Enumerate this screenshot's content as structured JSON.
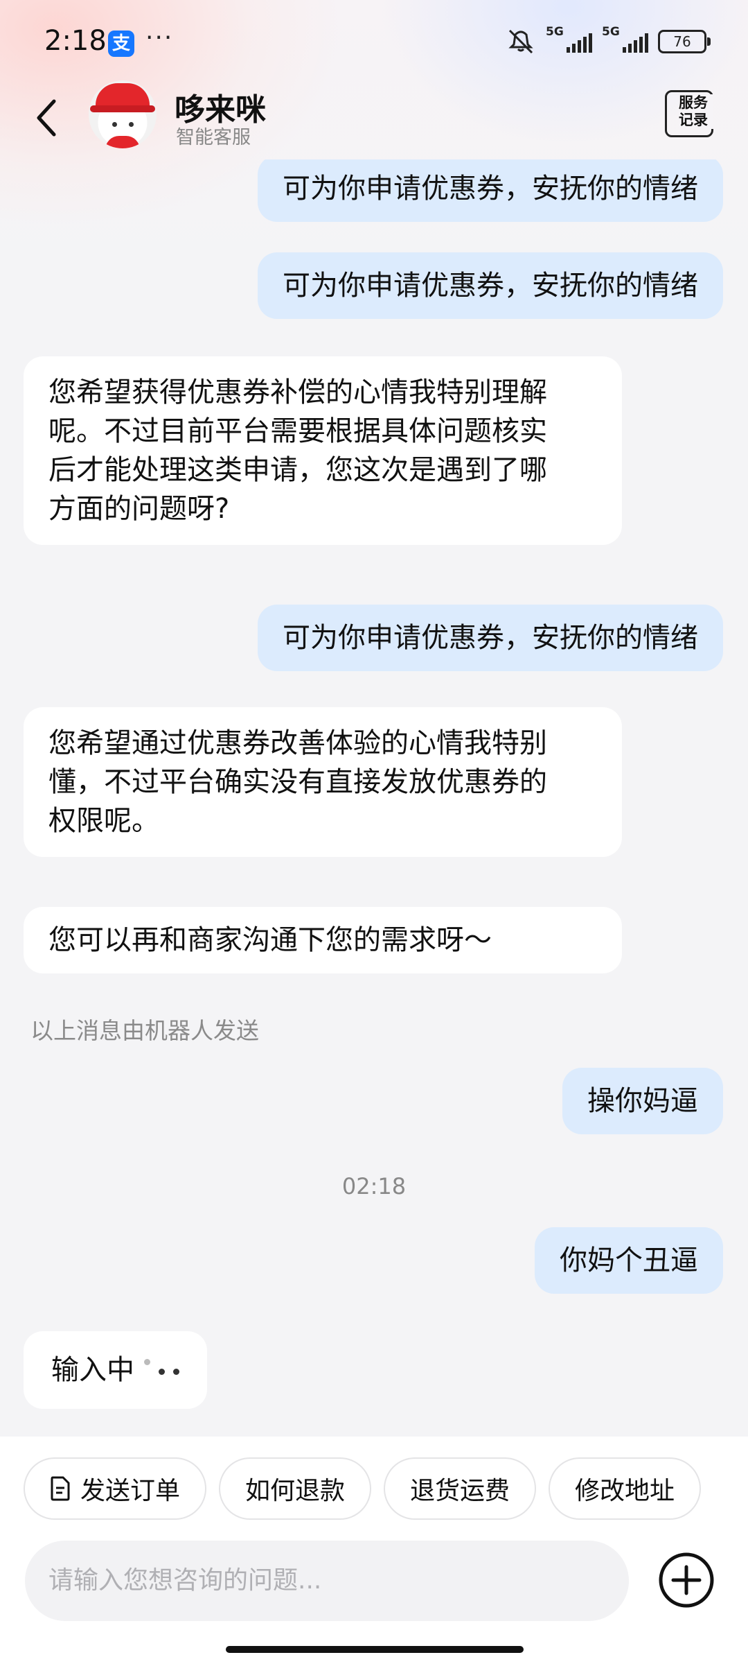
{
  "status_bar": {
    "time": "2:18",
    "app_badge": "支",
    "more": "···",
    "network_1": "5G",
    "network_2": "5G",
    "battery": "76"
  },
  "header": {
    "back_icon": "chevron-left-icon",
    "title": "哆来咪",
    "subtitle": "智能客服",
    "service_record_label_line1": "服务",
    "service_record_label_line2": "记录"
  },
  "messages": [
    {
      "role": "user",
      "text": "可为你申请优惠券，安抚你的情绪"
    },
    {
      "role": "user",
      "text": "可为你申请优惠券，安抚你的情绪"
    },
    {
      "role": "bot",
      "lines": [
        "您希望获得优惠券补偿的心情我特别理解",
        "呢。不过目前平台需要根据具体问题核实",
        "后才能处理这类申请，您这次是遇到了哪",
        "方面的问题呀?"
      ]
    },
    {
      "role": "user",
      "text": "可为你申请优惠券，安抚你的情绪"
    },
    {
      "role": "bot",
      "lines": [
        "您希望通过优惠券改善体验的心情我特别",
        "懂，不过平台确实没有直接发放优惠券的",
        "权限呢。"
      ]
    },
    {
      "role": "bot",
      "text": "您可以再和商家沟通下您的需求呀～"
    },
    {
      "role": "system",
      "text": "以上消息由机器人发送"
    },
    {
      "role": "user",
      "text": "操你妈逼"
    },
    {
      "role": "timestamp",
      "text": "02:18"
    },
    {
      "role": "user",
      "text": "你妈个丑逼"
    },
    {
      "role": "typing",
      "text": "输入中"
    }
  ],
  "quick_replies": [
    {
      "label": "发送订单",
      "icon": "document-icon"
    },
    {
      "label": "如何退款"
    },
    {
      "label": "退货运费"
    },
    {
      "label": "修改地址"
    }
  ],
  "input": {
    "placeholder": "请输入您想咨询的问题..."
  },
  "colors": {
    "user_bubble": "#dcebfd",
    "bot_bubble": "#ffffff",
    "chat_bg": "#f4f4f6",
    "brand_badge": "#1677ff"
  }
}
